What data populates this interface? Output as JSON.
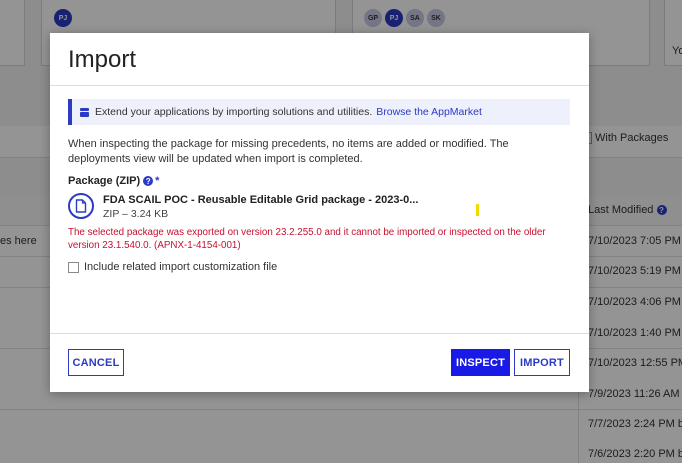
{
  "background": {
    "top_avatars_left": [
      "PJ"
    ],
    "top_avatars_right": [
      "GP",
      "PJ",
      "SA",
      "SK"
    ],
    "right_card_text": "Yo",
    "left_text": "es here",
    "with_packages_label": "With Packages",
    "last_modified_header": "Last Modified",
    "rows": [
      "7/10/2023 7:05 PM",
      "7/10/2023 5:19 PM",
      "7/10/2023 4:06 PM",
      "7/10/2023 1:40 PM",
      "7/10/2023 12:55 PM",
      "7/9/2023 11:26 AM",
      "7/7/2023 2:24 PM b",
      "7/6/2023 2:20 PM b"
    ]
  },
  "modal": {
    "title": "Import",
    "banner": {
      "text": "Extend your applications by importing solutions and utilities.",
      "link": "Browse the AppMarket"
    },
    "info_text": "When inspecting the package for missing precedents, no items are added or modified. The deployments view will be updated when import is completed.",
    "package_label": "Package (ZIP)",
    "required_marker": "*",
    "help_glyph": "?",
    "file": {
      "name": "FDA SCAIL POC - Reusable Editable Grid package - 2023-0...",
      "meta": "ZIP – 3.24 KB"
    },
    "error_text": "The selected package was exported on version 23.2.255.0 and it cannot be imported or inspected on the older version 23.1.540.0. (APNX-1-4154-001)",
    "checkbox_label": "Include related import customization file",
    "buttons": {
      "cancel": "CANCEL",
      "inspect": "INSPECT",
      "import": "IMPORT"
    }
  },
  "colors": {
    "accent": "#2b3bc4",
    "primary_button": "#1a1ae6",
    "error": "#c8102e",
    "banner_bg": "#eef0fb"
  }
}
